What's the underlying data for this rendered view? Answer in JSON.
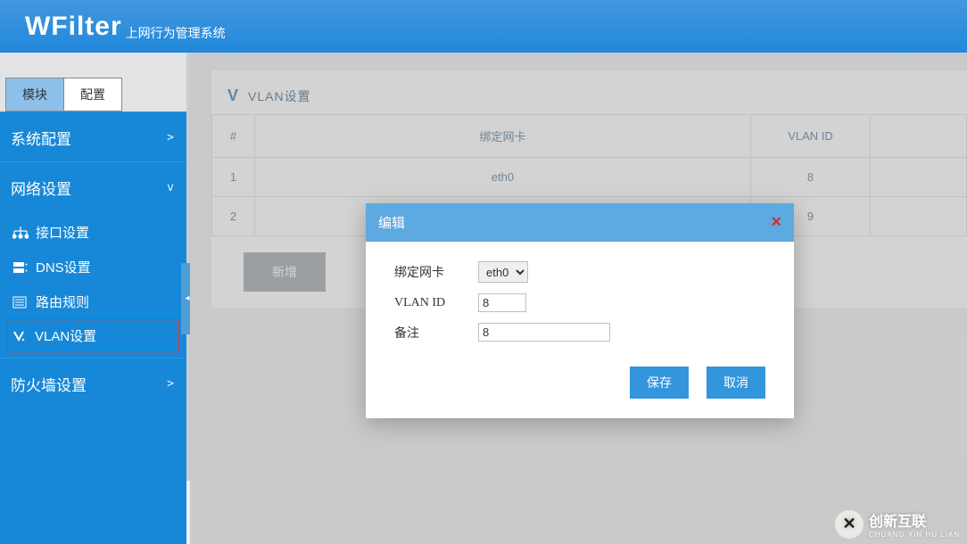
{
  "header": {
    "logo": "WFilter",
    "subtitle": "上网行为管理系统"
  },
  "sidebar": {
    "tabs": [
      {
        "label": "模块",
        "active": true
      },
      {
        "label": "配置",
        "active": false
      }
    ],
    "sections": [
      {
        "label": "系统配置",
        "expanded": false,
        "items": []
      },
      {
        "label": "网络设置",
        "expanded": true,
        "items": [
          {
            "label": "接口设置",
            "icon": "interface-icon"
          },
          {
            "label": "DNS设置",
            "icon": "dns-icon"
          },
          {
            "label": "路由规则",
            "icon": "route-icon"
          },
          {
            "label": "VLAN设置",
            "icon": "vlan-icon",
            "selected": true
          }
        ]
      },
      {
        "label": "防火墙设置",
        "expanded": false,
        "items": []
      }
    ]
  },
  "panel": {
    "title": "VLAN设置",
    "columns": {
      "idx": "#",
      "bind": "绑定网卡",
      "vlan": "VLAN ID",
      "remark": ""
    },
    "rows": [
      {
        "idx": "1",
        "bind": "eth0",
        "vlan": "8"
      },
      {
        "idx": "2",
        "bind": "",
        "vlan": "9"
      }
    ],
    "add_label": "新增"
  },
  "modal": {
    "title": "编辑",
    "close": "×",
    "fields": {
      "bind": {
        "label": "绑定网卡",
        "value": "eth0"
      },
      "vlan_id": {
        "label": "VLAN ID",
        "value": "8"
      },
      "remark": {
        "label": "备注",
        "value": "8"
      }
    },
    "save_label": "保存",
    "cancel_label": "取消"
  },
  "footer": {
    "brand": "创新互联",
    "sub": "CHUANG XIN HU LIAN",
    "mark": "✕"
  }
}
